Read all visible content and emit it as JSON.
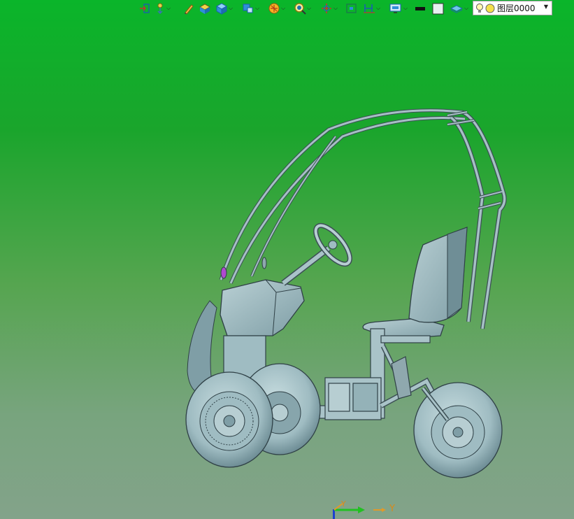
{
  "toolbar": {
    "icons": [
      {
        "name": "csys-icon",
        "dropdown": false
      },
      {
        "name": "snap-point-icon",
        "dropdown": true
      },
      {
        "name": "pencil-icon",
        "dropdown": false
      },
      {
        "name": "box-solid-icon",
        "dropdown": false
      },
      {
        "name": "cube-icon",
        "dropdown": true
      },
      {
        "name": "view-orient-icon",
        "dropdown": true
      },
      {
        "name": "render-style-icon",
        "dropdown": true
      },
      {
        "name": "zoom-icon",
        "dropdown": true
      },
      {
        "name": "section-icon",
        "dropdown": true
      },
      {
        "name": "fit-view-icon",
        "dropdown": false
      },
      {
        "name": "measure-icon",
        "dropdown": true
      },
      {
        "name": "display-settings-icon",
        "dropdown": true
      },
      {
        "name": "color-black-swatch",
        "dropdown": false
      },
      {
        "name": "color-white-swatch",
        "dropdown": false
      },
      {
        "name": "layer-shade-icon",
        "dropdown": true
      }
    ],
    "layer_select": {
      "value": "图层0000",
      "icons": [
        "lightbulb-icon",
        "layer-color-icon"
      ]
    },
    "colors": {
      "black_swatch": "#111111",
      "white_swatch": "#e8f0f0"
    }
  },
  "viewport": {
    "background_top": "#0ab52a",
    "background_bottom": "#83a38a",
    "model_color": "#a9c3c8"
  },
  "triad": {
    "y_label": "Y",
    "y_label_small": "Y"
  }
}
